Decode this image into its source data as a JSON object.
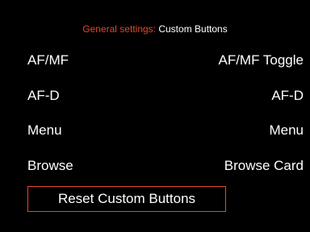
{
  "header": {
    "section": "General settings:",
    "page": "Custom Buttons"
  },
  "rows": [
    {
      "label": "AF/MF",
      "value": "AF/MF Toggle"
    },
    {
      "label": "AF-D",
      "value": "AF-D"
    },
    {
      "label": "Menu",
      "value": "Menu"
    },
    {
      "label": "Browse",
      "value": "Browse Card"
    }
  ],
  "reset_button": {
    "label": "Reset Custom Buttons"
  },
  "colors": {
    "accent": "#e8452a",
    "background": "#000000",
    "text": "#ffffff"
  }
}
